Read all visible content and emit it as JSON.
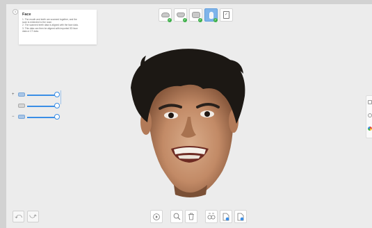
{
  "info_panel": {
    "step_badge": "1",
    "title": "Face",
    "lines": [
      "1. The mouth and teeth are scanned together, and the",
      "scan is extended to the nose.",
      "2. The scanned teeth data is aligned with the face data.",
      "3. This data can then be aligned with imported 3D face",
      "data or CT data."
    ]
  },
  "top_toolbar": {
    "tools": [
      {
        "icon": "upper-jaw-icon",
        "completed": true,
        "active": false
      },
      {
        "icon": "lower-jaw-icon",
        "completed": true,
        "active": false
      },
      {
        "icon": "bite-icon",
        "completed": true,
        "active": false
      },
      {
        "icon": "tooth-icon",
        "completed": true,
        "active": true
      },
      {
        "icon": "clipboard-check-icon",
        "completed": false,
        "active": false
      }
    ]
  },
  "sliders": [
    {
      "sign": "+",
      "icon": "upper-jaw-icon",
      "value": 1.0
    },
    {
      "sign": "",
      "icon": "tooth-icon",
      "value": 1.0
    },
    {
      "sign": "−",
      "icon": "lower-jaw-icon",
      "value": 1.0
    }
  ],
  "right_panel": {
    "icons": [
      "image-icon",
      "circle-icon",
      "color-palette-icon"
    ]
  },
  "bottom_left": {
    "undo_glyph": "⤺",
    "redo_glyph": "⤻"
  },
  "bottom_toolbar": {
    "tools": [
      "play-icon",
      "zoom-search-icon",
      "trash-icon",
      "face-scan-icon",
      "file-edit-icon",
      "file-check-icon"
    ]
  },
  "colors": {
    "accent": "#3a8ee6",
    "active_tool": "#7fb4ea",
    "check": "#3db049",
    "background": "#ececec"
  }
}
